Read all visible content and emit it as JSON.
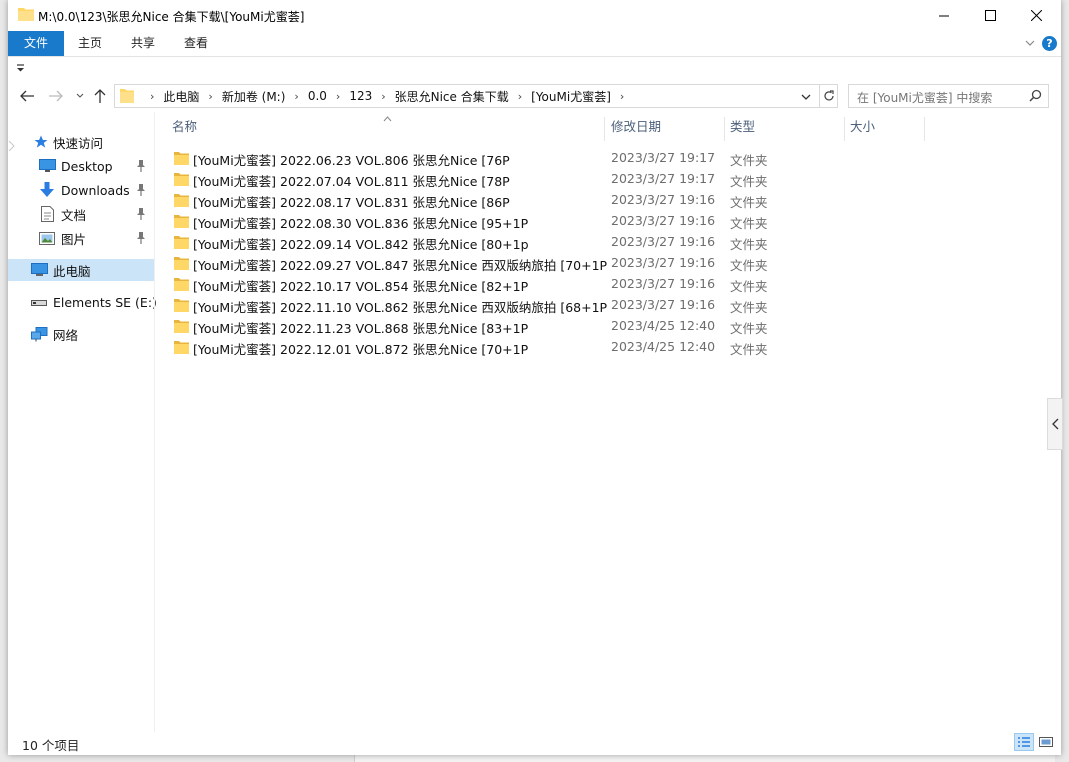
{
  "window": {
    "title": "M:\\0.0\\123\\张思允Nice 合集下载\\[YouMi尤蜜荟]"
  },
  "ribbon": {
    "tabs": [
      {
        "label": "文件",
        "active": true
      },
      {
        "label": "主页",
        "active": false
      },
      {
        "label": "共享",
        "active": false
      },
      {
        "label": "查看",
        "active": false
      }
    ],
    "help_label": "?"
  },
  "address": {
    "breadcrumbs": [
      "此电脑",
      "新加卷 (M:)",
      "0.0",
      "123",
      "张思允Nice 合集下载",
      "[YouMi尤蜜荟]"
    ]
  },
  "search": {
    "placeholder": "在 [YouMi尤蜜荟] 中搜索"
  },
  "sidebar": {
    "items": [
      {
        "label": "快速访问",
        "icon": "star-icon"
      },
      {
        "label": "Desktop",
        "icon": "desktop-icon",
        "pinned": true
      },
      {
        "label": "Downloads",
        "icon": "download-arrow-icon",
        "pinned": true
      },
      {
        "label": "文档",
        "icon": "document-icon",
        "pinned": true
      },
      {
        "label": "图片",
        "icon": "pictures-icon",
        "pinned": true
      },
      {
        "label": "此电脑",
        "icon": "computer-icon",
        "selected": true
      },
      {
        "label": "Elements SE (E:)",
        "icon": "drive-icon"
      },
      {
        "label": "网络",
        "icon": "network-icon"
      }
    ]
  },
  "columns": {
    "name": "名称",
    "date": "修改日期",
    "type": "类型",
    "size": "大小"
  },
  "files": [
    {
      "name": "[YouMi尤蜜荟] 2022.06.23 VOL.806 张思允Nice [76P",
      "date": "2023/3/27 19:17",
      "type": "文件夹"
    },
    {
      "name": "[YouMi尤蜜荟] 2022.07.04 VOL.811 张思允Nice [78P",
      "date": "2023/3/27 19:17",
      "type": "文件夹"
    },
    {
      "name": "[YouMi尤蜜荟] 2022.08.17 VOL.831 张思允Nice [86P",
      "date": "2023/3/27 19:16",
      "type": "文件夹"
    },
    {
      "name": "[YouMi尤蜜荟] 2022.08.30 VOL.836 张思允Nice [95+1P",
      "date": "2023/3/27 19:16",
      "type": "文件夹"
    },
    {
      "name": "[YouMi尤蜜荟] 2022.09.14 VOL.842 张思允Nice [80+1p",
      "date": "2023/3/27 19:16",
      "type": "文件夹"
    },
    {
      "name": "[YouMi尤蜜荟] 2022.09.27 VOL.847 张思允Nice 西双版纳旅拍 [70+1P",
      "date": "2023/3/27 19:16",
      "type": "文件夹"
    },
    {
      "name": "[YouMi尤蜜荟] 2022.10.17 VOL.854 张思允Nice [82+1P",
      "date": "2023/3/27 19:16",
      "type": "文件夹"
    },
    {
      "name": "[YouMi尤蜜荟] 2022.11.10 VOL.862 张思允Nice 西双版纳旅拍 [68+1P",
      "date": "2023/3/27 19:16",
      "type": "文件夹"
    },
    {
      "name": "[YouMi尤蜜荟] 2022.11.23 VOL.868 张思允Nice [83+1P",
      "date": "2023/4/25 12:40",
      "type": "文件夹"
    },
    {
      "name": "[YouMi尤蜜荟] 2022.12.01 VOL.872 张思允Nice [70+1P",
      "date": "2023/4/25 12:40",
      "type": "文件夹"
    }
  ],
  "status": {
    "item_count": "10 个项目"
  },
  "colors": {
    "accent": "#1979ca",
    "selection": "#cce4f7",
    "folder": "#ffd767"
  }
}
